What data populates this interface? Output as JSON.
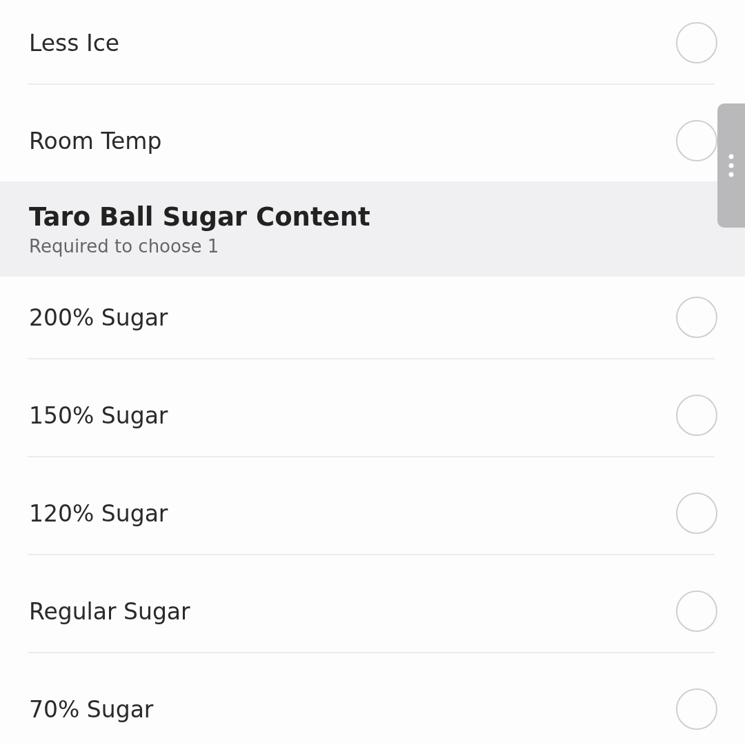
{
  "groups": [
    {
      "options": [
        {
          "label": "Less Ice",
          "selected": false
        },
        {
          "label": "Room Temp",
          "selected": false
        }
      ]
    },
    {
      "title": "Taro Ball Sugar Content",
      "subtitle": "Required to choose 1",
      "options": [
        {
          "label": "200% Sugar",
          "selected": false
        },
        {
          "label": "150% Sugar",
          "selected": false
        },
        {
          "label": "120% Sugar",
          "selected": false
        },
        {
          "label": "Regular Sugar",
          "selected": false
        },
        {
          "label": "70% Sugar",
          "selected": false
        }
      ]
    }
  ]
}
